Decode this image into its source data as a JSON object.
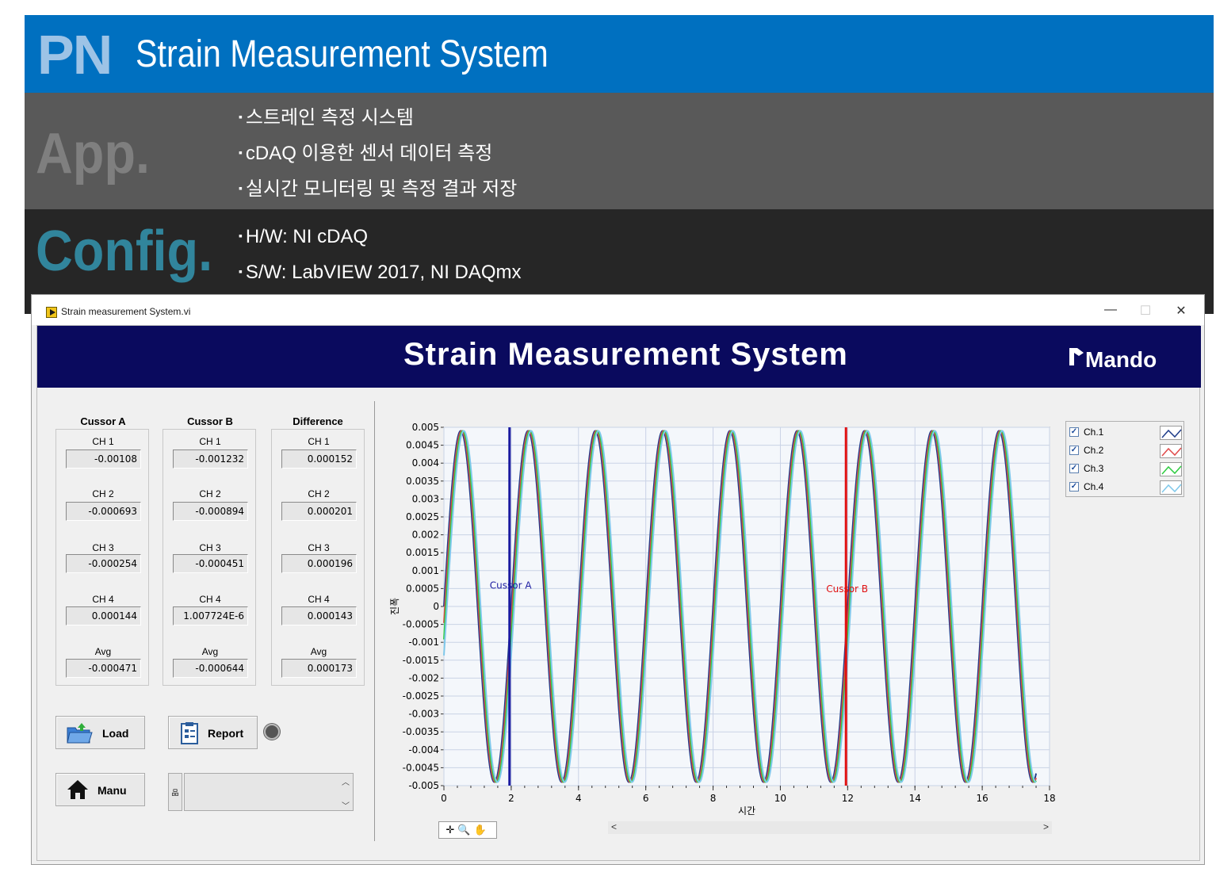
{
  "slide": {
    "pn_tag": "PN",
    "title": "Strain Measurement System",
    "app_tag": "App.",
    "app_bullets": [
      "스트레인 측정 시스템",
      "cDAQ 이용한 센서 데이터 측정",
      "실시간 모니터링 및 측정 결과 저장"
    ],
    "config_tag": "Config.",
    "config_bullets": [
      "H/W: NI cDAQ",
      "S/W: LabVIEW 2017, NI DAQmx"
    ]
  },
  "window": {
    "title": "Strain measurement System.vi",
    "minimize": "—",
    "maximize": "☐",
    "close": "✕"
  },
  "banner": {
    "title": "Strain Measurement System",
    "logo": "Mando"
  },
  "readouts": {
    "cursor_a": {
      "heading": "Cussor A",
      "rows": [
        {
          "label": "CH 1",
          "value": "-0.00108"
        },
        {
          "label": "CH 2",
          "value": "-0.000693"
        },
        {
          "label": "CH 3",
          "value": "-0.000254"
        },
        {
          "label": "CH 4",
          "value": "0.000144"
        },
        {
          "label": "Avg",
          "value": "-0.000471"
        }
      ]
    },
    "cursor_b": {
      "heading": "Cussor B",
      "rows": [
        {
          "label": "CH 1",
          "value": "-0.001232"
        },
        {
          "label": "CH 2",
          "value": "-0.000894"
        },
        {
          "label": "CH 3",
          "value": "-0.000451"
        },
        {
          "label": "CH 4",
          "value": "1.007724E-6"
        },
        {
          "label": "Avg",
          "value": "-0.000644"
        }
      ]
    },
    "difference": {
      "heading": "Difference",
      "rows": [
        {
          "label": "CH 1",
          "value": "0.000152"
        },
        {
          "label": "CH 2",
          "value": "0.000201"
        },
        {
          "label": "CH 3",
          "value": "0.000196"
        },
        {
          "label": "CH 4",
          "value": "0.000143"
        },
        {
          "label": "Avg",
          "value": "0.000173"
        }
      ]
    }
  },
  "buttons": {
    "load": "Load",
    "report": "Report",
    "menu": "Manu"
  },
  "path_prefix": "品",
  "palette": "✛🔍✋",
  "scroll": {
    "left": "<",
    "right": ">"
  },
  "chart_data": {
    "type": "line",
    "xlabel": "시간",
    "ylabel": "진폭",
    "xlim": [
      0,
      18
    ],
    "ylim": [
      -0.005,
      0.005
    ],
    "x_ticks": [
      "0",
      "2",
      "4",
      "6",
      "8",
      "10",
      "12",
      "14",
      "16",
      "18"
    ],
    "y_ticks": [
      "0.005",
      "0.0045",
      "0.004",
      "0.0035",
      "0.003",
      "0.0025",
      "0.002",
      "0.0015",
      "0.001",
      "0.0005",
      "0",
      "-0.0005",
      "-0.001",
      "-0.0015",
      "-0.002",
      "-0.0025",
      "-0.003",
      "-0.0035",
      "-0.004",
      "-0.0045",
      "-0.005"
    ],
    "signal": {
      "amplitude": 0.0049,
      "period": 2.0,
      "x_end": 17.6,
      "phase_at_zero": 0
    },
    "series": [
      {
        "name": "Ch.1",
        "color": "#1f3d8a",
        "phase_shift": 0.0
      },
      {
        "name": "Ch.2",
        "color": "#e04a4a",
        "phase_shift": 0.03
      },
      {
        "name": "Ch.3",
        "color": "#2ecc40",
        "phase_shift": 0.06
      },
      {
        "name": "Ch.4",
        "color": "#7fc8ea",
        "phase_shift": 0.09
      }
    ],
    "cursors": [
      {
        "name": "Cussor A",
        "x": 1.95,
        "color": "#1a1aa0"
      },
      {
        "name": "Cussor B",
        "x": 11.95,
        "color": "#e01010"
      }
    ]
  }
}
